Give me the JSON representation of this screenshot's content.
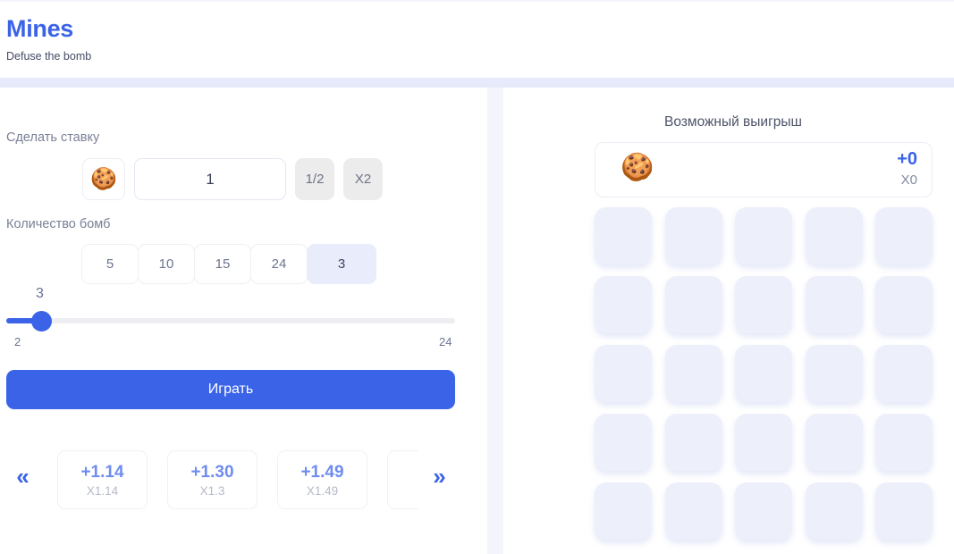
{
  "header": {
    "title": "Mines",
    "subtitle": "Defuse the bomb"
  },
  "bet": {
    "label": "Сделать ставку",
    "coin_icon": "cookie-icon",
    "coin_glyph": "🍪",
    "amount": "1",
    "placeholder": "1",
    "half_label": "1/2",
    "double_label": "X2"
  },
  "bombs": {
    "label": "Количество бомб",
    "presets": [
      "5",
      "10",
      "15",
      "24"
    ],
    "selected": "3",
    "slider": {
      "value": "3",
      "min": "2",
      "max": "24"
    }
  },
  "play": {
    "label": "Играть"
  },
  "carousel": {
    "prev_icon": "double-chevron-left-icon",
    "next_icon": "double-chevron-right-icon",
    "prev_glyph": "«",
    "next_glyph": "»",
    "cards": [
      {
        "payout": "+1.14",
        "multiplier": "X1.14"
      },
      {
        "payout": "+1.30",
        "multiplier": "X1.3"
      },
      {
        "payout": "+1.49",
        "multiplier": "X1.49"
      },
      {
        "payout": "",
        "multiplier": ""
      }
    ]
  },
  "win": {
    "title": "Возможный выигрыш",
    "coin_icon": "cookie-icon",
    "coin_glyph": "🍪",
    "amount": "+0",
    "multiplier": "X0"
  },
  "board": {
    "rows": 5,
    "cols": 5,
    "tiles": [
      "tile-1",
      "tile-2",
      "tile-3",
      "tile-4",
      "tile-5",
      "tile-6",
      "tile-7",
      "tile-8",
      "tile-9",
      "tile-10",
      "tile-11",
      "tile-12",
      "tile-13",
      "tile-14",
      "tile-15",
      "tile-16",
      "tile-17",
      "tile-18",
      "tile-19",
      "tile-20",
      "tile-21",
      "tile-22",
      "tile-23",
      "tile-24",
      "tile-25"
    ]
  },
  "colors": {
    "accent": "#3b63e8",
    "tile": "#edeffa",
    "band": "#e7eafa",
    "muted": "#7a8095"
  }
}
